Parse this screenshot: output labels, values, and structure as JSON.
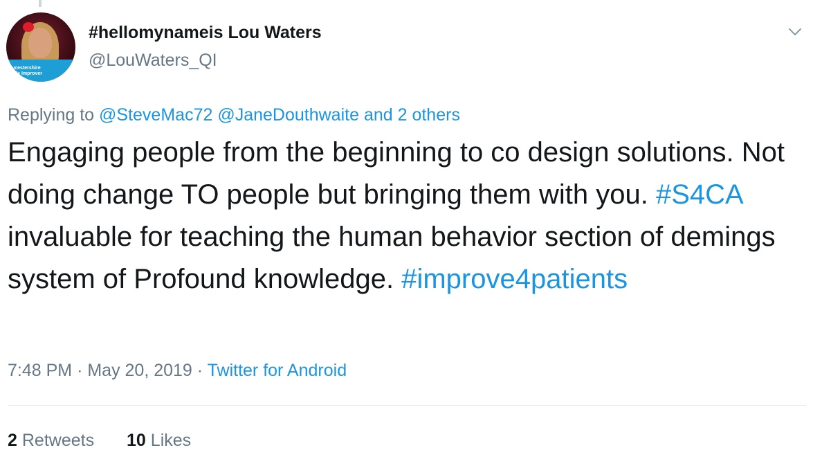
{
  "author": {
    "display_name": "#hellomynameis Lou Waters",
    "handle": "@LouWaters_QI",
    "avatar_banner_text": "ucestershire\ntals Improver"
  },
  "menu": {
    "icon": "chevron-down-icon"
  },
  "reply": {
    "prefix": "Replying to",
    "mention_1": "@SteveMac72",
    "mention_2": "@JaneDouthwaite",
    "others": "and 2 others"
  },
  "tweet": {
    "text_1": "Engaging people from the beginning to co design solutions. Not doing change TO people but bringing them with you.",
    "hashtag_1": "#S4CA",
    "text_2": "invaluable for teaching the human behavior section of demings system of Profound knowledge.",
    "hashtag_2": "#improve4patients"
  },
  "meta": {
    "time": "7:48 PM",
    "separator": "·",
    "date": "May 20, 2019",
    "source": "Twitter for Android"
  },
  "stats": {
    "retweets_count": "2",
    "retweets_label": "Retweets",
    "likes_count": "10",
    "likes_label": "Likes"
  },
  "colors": {
    "link": "#1b95e0",
    "secondary_text": "#657786",
    "primary_text": "#14171a",
    "divider": "#e6ecf0"
  }
}
